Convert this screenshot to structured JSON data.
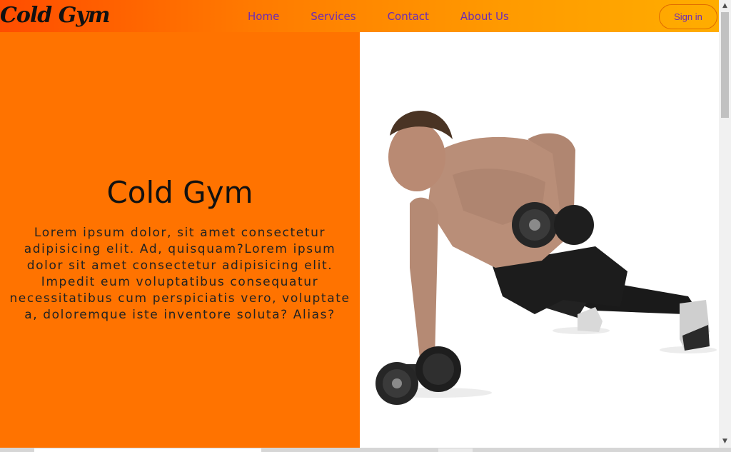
{
  "nav": {
    "logo": "Cold Gym",
    "links": [
      "Home",
      "Services",
      "Contact",
      "About Us"
    ],
    "signin": "Sign in"
  },
  "hero": {
    "title": "Cold Gym",
    "text": "Lorem ipsum dolor, sit amet consectetur adipisicing elit. Ad, quisquam?Lorem ipsum dolor sit amet consectetur adipisicing elit. Impedit eum voluptatibus consequatur necessitatibus cum perspiciatis vero, voluptate a, doloremque iste inventore soluta? Alias?"
  },
  "colors": {
    "accent": "#ff7300",
    "link": "#6b2bb7"
  },
  "icons": {
    "scroll_up": "triangle-up",
    "scroll_down": "triangle-down"
  }
}
